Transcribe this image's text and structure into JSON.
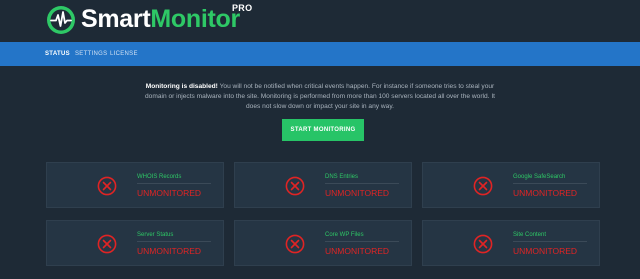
{
  "brand": {
    "name_part1": "Smart",
    "name_part2": "Monitor",
    "badge": "PRO",
    "accent_color": "#2ec866",
    "logo_icon": "pulse-shield-icon"
  },
  "nav": {
    "items": [
      {
        "label": "STATUS",
        "active": true
      },
      {
        "label": "SETTINGS",
        "active": false
      },
      {
        "label": "LICENSE",
        "active": false
      }
    ],
    "color": "#2475c8"
  },
  "notice": {
    "strong": "Monitoring is disabled!",
    "text": " You will not be notified when critical events happen. For instance if someone tries to steal your domain or injects malware into the site. Monitoring is performed from more than 100 servers located all over the world. It does not slow down or impact your site in any way."
  },
  "start_button": {
    "label": "START MONITORING",
    "color": "#27c467"
  },
  "cards": [
    {
      "title": "WHOIS Records",
      "status": "UNMONITORED",
      "icon": "x-circle-icon"
    },
    {
      "title": "DNS Entries",
      "status": "UNMONITORED",
      "icon": "x-circle-icon"
    },
    {
      "title": "Google SafeSearch",
      "status": "UNMONITORED",
      "icon": "x-circle-icon"
    },
    {
      "title": "Server Status",
      "status": "UNMONITORED",
      "icon": "x-circle-icon"
    },
    {
      "title": "Core WP Files",
      "status": "UNMONITORED",
      "icon": "x-circle-icon"
    },
    {
      "title": "Site Content",
      "status": "UNMONITORED",
      "icon": "x-circle-icon"
    }
  ],
  "colors": {
    "error": "#e02424",
    "background": "#1e2a36",
    "card": "#253544"
  }
}
